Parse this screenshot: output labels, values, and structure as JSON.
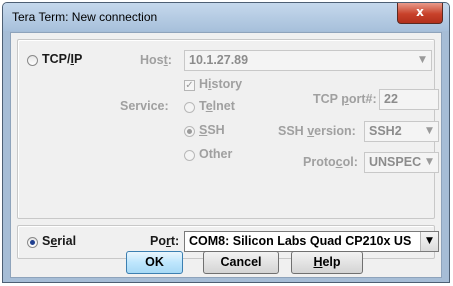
{
  "window": {
    "title": "Tera Term: New connection",
    "close_glyph": "x"
  },
  "tcpip": {
    "radio_label_pre": "TCP/",
    "radio_label_u": "I",
    "radio_label_post": "P",
    "selected": false,
    "host_label_pre": "Hos",
    "host_label_u": "t",
    "host_label_post": ":",
    "host_value": "10.1.27.89",
    "history_label_pre": "H",
    "history_label_u": "i",
    "history_label_post": "story",
    "history_checked": true,
    "service_label": "Service:",
    "services": {
      "telnet_pre": "T",
      "telnet_u": "e",
      "telnet_post": "lnet",
      "ssh_u": "S",
      "ssh_post": "SH",
      "other": "Other",
      "selected": "SSH"
    },
    "tcp_port_label_pre": "TCP ",
    "tcp_port_label_u": "p",
    "tcp_port_label_post": "ort#:",
    "tcp_port_value": "22",
    "ssh_version_label_pre": "SSH ",
    "ssh_version_label_u": "v",
    "ssh_version_label_post": "ersion:",
    "ssh_version_value": "SSH2",
    "protocol_label_pre": "Proto",
    "protocol_label_u": "c",
    "protocol_label_post": "ol:",
    "protocol_value": "UNSPEC"
  },
  "serial": {
    "radio_label_pre": "S",
    "radio_label_u": "e",
    "radio_label_post": "rial",
    "selected": true,
    "port_label_pre": "Po",
    "port_label_u": "r",
    "port_label_post": "t:",
    "port_value": "COM8: Silicon Labs Quad CP210x US"
  },
  "buttons": {
    "ok": "OK",
    "cancel": "Cancel",
    "help_u": "H",
    "help_post": "elp"
  },
  "icons": {
    "close": "close-icon",
    "dropdown": "chevron-down-icon",
    "checkmark": "check-icon"
  }
}
